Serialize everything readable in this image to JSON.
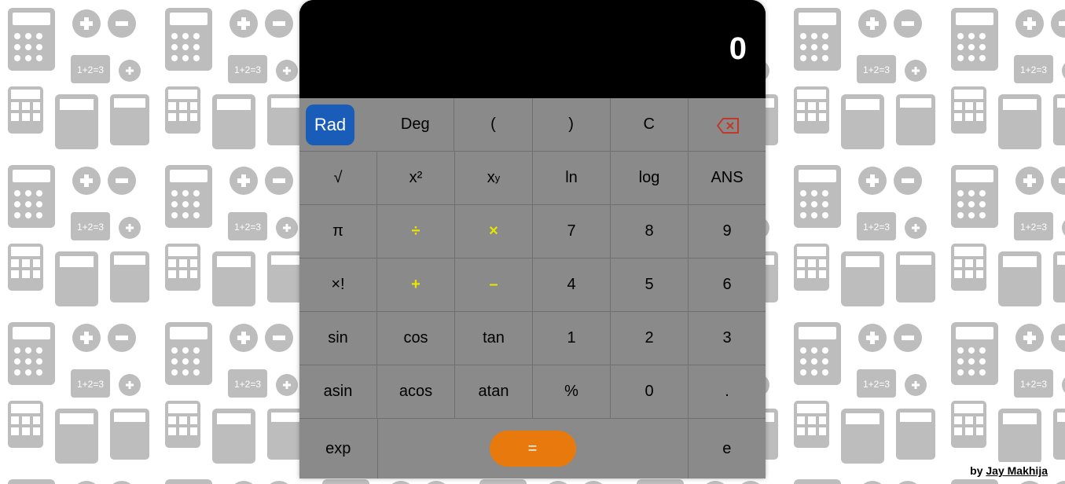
{
  "display": {
    "value": "0"
  },
  "rows": [
    {
      "rad": "Rad",
      "deg": "Deg",
      "lparen": "(",
      "rparen": ")",
      "clear": "C"
    },
    {
      "sqrt": "√",
      "sq": "x²",
      "pow": "x",
      "pow_sup": "y",
      "ln": "ln",
      "log": "log",
      "ans": "ANS"
    },
    {
      "pi": "π",
      "div": "÷",
      "mul": "×",
      "n7": "7",
      "n8": "8",
      "n9": "9"
    },
    {
      "fact": "×!",
      "add": "+",
      "sub": "–",
      "n4": "4",
      "n5": "5",
      "n6": "6"
    },
    {
      "sin": "sin",
      "cos": "cos",
      "tan": "tan",
      "n1": "1",
      "n2": "2",
      "n3": "3"
    },
    {
      "asin": "asin",
      "acos": "acos",
      "atan": "atan",
      "pct": "%",
      "n0": "0",
      "dot": "."
    },
    {
      "exp": "exp",
      "eq": "=",
      "e": "e"
    }
  ],
  "credit": {
    "by": "by ",
    "name": "Jay Makhija"
  }
}
